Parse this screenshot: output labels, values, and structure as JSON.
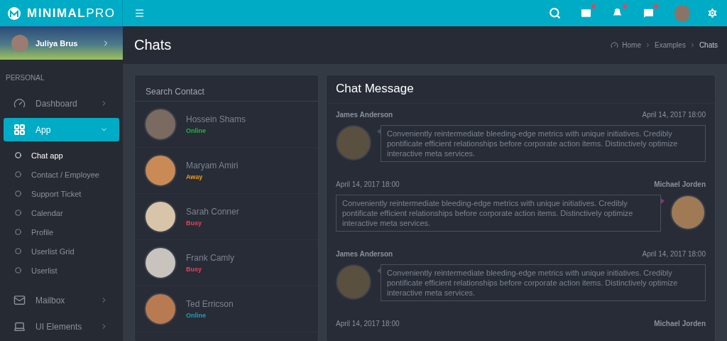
{
  "brand": {
    "bold": "MINIMAL",
    "light": "PRO"
  },
  "toolbar": [
    {
      "kind": "search",
      "badge": false
    },
    {
      "kind": "mail",
      "badge": true
    },
    {
      "kind": "bell",
      "badge": true
    },
    {
      "kind": "chat",
      "badge": true
    },
    {
      "kind": "avatar",
      "badge": false
    },
    {
      "kind": "settings",
      "badge": false
    }
  ],
  "user": {
    "name": "Juliya Brus"
  },
  "sidebar": {
    "section": "PERSONAL",
    "items": [
      {
        "label": "Dashboard",
        "kind": "gauge",
        "selected": false,
        "expanded": false
      },
      {
        "label": "App",
        "kind": "grid",
        "selected": true,
        "expanded": true,
        "children": [
          {
            "label": "Chat app",
            "selected": true
          },
          {
            "label": "Contact / Employee",
            "selected": false
          },
          {
            "label": "Support Ticket",
            "selected": false
          },
          {
            "label": "Calendar",
            "selected": false
          },
          {
            "label": "Profile",
            "selected": false
          },
          {
            "label": "Userlist Grid",
            "selected": false
          },
          {
            "label": "Userlist",
            "selected": false
          }
        ]
      },
      {
        "label": "Mailbox",
        "kind": "mail",
        "selected": false,
        "expanded": false
      },
      {
        "label": "UI Elements",
        "kind": "laptop",
        "selected": false,
        "expanded": false
      }
    ]
  },
  "page": {
    "title": "Chats",
    "breadcrumb": [
      "Home",
      "Examples",
      "Chats"
    ]
  },
  "contacts": {
    "title": "Search Contact",
    "items": [
      {
        "name": "Hossein Shams",
        "status": "Online",
        "color": "#1fb73a"
      },
      {
        "name": "Maryam Amiri",
        "status": "Away",
        "color": "#f39c12"
      },
      {
        "name": "Sarah Conner",
        "status": "Busy",
        "color": "#ee3f57"
      },
      {
        "name": "Frank Camly",
        "status": "Busy",
        "color": "#ee3f57"
      },
      {
        "name": "Ted Erricson",
        "status": "Online",
        "color": "#17a2b8"
      }
    ]
  },
  "chat": {
    "title": "Chat Message",
    "messages": [
      {
        "kind": "incoming",
        "name": "James Anderson",
        "time": "April 14, 2017 18:00",
        "text": "Conveniently reintermediate bleeding-edge metrics with unique initiatives. Credibly pontificate efficient relationships before corporate action items. Distinctively optimize interactive meta services."
      },
      {
        "kind": "outgoing",
        "name": "Michael Jorden",
        "time": "April 14, 2017 18:00",
        "text": "Conveniently reintermediate bleeding-edge metrics with unique initiatives. Credibly pontificate efficient relationships before corporate action items. Distinctively optimize interactive meta services."
      },
      {
        "kind": "incoming",
        "name": "James Anderson",
        "time": "April 14, 2017 18:00",
        "text": "Conveniently reintermediate bleeding-edge metrics with unique initiatives. Credibly pontificate efficient relationships before corporate action items. Distinctively optimize interactive meta services."
      },
      {
        "kind": "outgoing",
        "name": "Michael Jorden",
        "time": "April 14, 2017 18:00"
      }
    ]
  }
}
